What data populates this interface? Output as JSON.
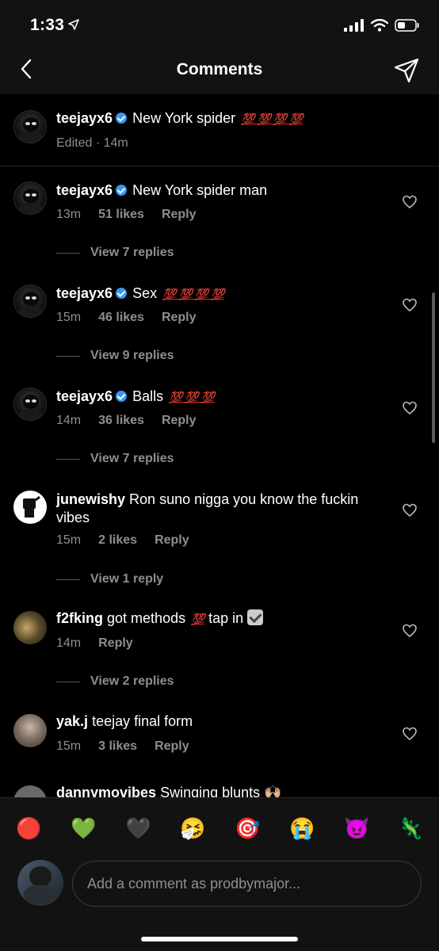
{
  "status": {
    "time": "1:33"
  },
  "header": {
    "title": "Comments"
  },
  "caption": {
    "username": "teejayx6",
    "text": "New York spider",
    "badges": "💯 💯 💯 💯",
    "meta": "Edited · 14m"
  },
  "comments": [
    {
      "username": "teejayx6",
      "text": "New York spider man",
      "badges": "",
      "time": "13m",
      "likes": "51 likes",
      "reply": "Reply",
      "view": "View 7 replies"
    },
    {
      "username": "teejayx6",
      "text": "Sex",
      "badges": "💯 💯 💯 💯",
      "time": "15m",
      "likes": "46 likes",
      "reply": "Reply",
      "view": "View 9 replies"
    },
    {
      "username": "teejayx6",
      "text": "Balls",
      "badges": "💯 💯 💯",
      "time": "14m",
      "likes": "36 likes",
      "reply": "Reply",
      "view": "View 7 replies"
    },
    {
      "username": "junewishy",
      "text": "Ron suno nigga you know the fuckin vibes",
      "time": "15m",
      "likes": "2 likes",
      "reply": "Reply",
      "view": "View 1 reply"
    },
    {
      "username": "f2fking",
      "text": "got methods",
      "badge": "💯",
      "text2": "tap in",
      "time": "14m",
      "reply": "Reply",
      "view": "View 2 replies"
    },
    {
      "username": "yak.j",
      "text": "teejay final form",
      "time": "15m",
      "likes": "3 likes",
      "reply": "Reply"
    },
    {
      "username": "dannymovibes",
      "text": "Swinging blunts 🙌🏼"
    }
  ],
  "emoji_bar": [
    "🔴",
    "💚",
    "🖤",
    "🤧",
    "🎯",
    "😭",
    "😈",
    "🦎"
  ],
  "input": {
    "placeholder": "Add a comment as prodbymajor..."
  },
  "colors": {
    "background": "#000000",
    "bar": "#121212",
    "muted": "#8e8e8e",
    "verified": "#3897f0",
    "hundred": "#e0282c"
  }
}
